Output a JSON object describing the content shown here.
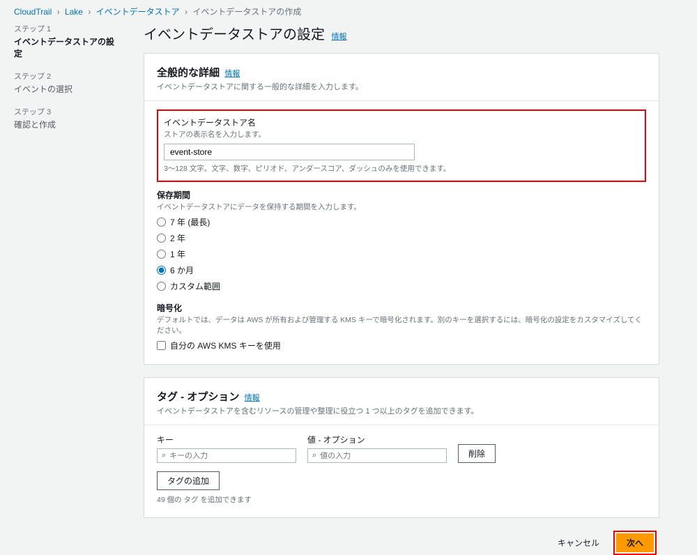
{
  "breadcrumb": {
    "items": [
      "CloudTrail",
      "Lake",
      "イベントデータストア"
    ],
    "current": "イベントデータストアの作成"
  },
  "sidebar": {
    "steps": [
      {
        "num": "ステップ 1",
        "label": "イベントデータストアの設定",
        "active": true
      },
      {
        "num": "ステップ 2",
        "label": "イベントの選択",
        "active": false
      },
      {
        "num": "ステップ 3",
        "label": "確認と作成",
        "active": false
      }
    ]
  },
  "page": {
    "title": "イベントデータストアの設定",
    "info": "情報"
  },
  "general": {
    "header": "全般的な詳細",
    "info": "情報",
    "desc": "イベントデータストアに関する一般的な詳細を入力します。",
    "name_label": "イベントデータストア名",
    "name_hint": "ストアの表示名を入力します。",
    "name_value": "event-store",
    "name_rule": "3～128 文字。文字、数字、ピリオド、アンダースコア、ダッシュのみを使用できます。",
    "retention_label": "保存期間",
    "retention_hint": "イベントデータストアにデータを保持する期間を入力します。",
    "retention_options": [
      {
        "label": "7 年 (最長)",
        "value": "7y"
      },
      {
        "label": "2 年",
        "value": "2y"
      },
      {
        "label": "1 年",
        "value": "1y"
      },
      {
        "label": "6 か月",
        "value": "6m"
      },
      {
        "label": "カスタム範囲",
        "value": "custom"
      }
    ],
    "retention_selected": "6m",
    "encrypt_label": "暗号化",
    "encrypt_hint": "デフォルトでは、データは AWS が所有および管理する KMS キーで暗号化されます。別のキーを選択するには、暗号化の設定をカスタマイズしてください。",
    "encrypt_checkbox": "自分の AWS KMS キーを使用"
  },
  "tags": {
    "header": "タグ - オプション",
    "info": "情報",
    "desc": "イベントデータストアを含むリソースの管理や整理に役立つ 1 つ以上のタグを追加できます。",
    "key_label": "キー",
    "key_placeholder": "キーの入力",
    "value_label": "値 - オプション",
    "value_placeholder": "値の入力",
    "remove": "削除",
    "add": "タグの追加",
    "limit": "49 個の タグ を追加できます"
  },
  "footer": {
    "cancel": "キャンセル",
    "next": "次へ"
  }
}
